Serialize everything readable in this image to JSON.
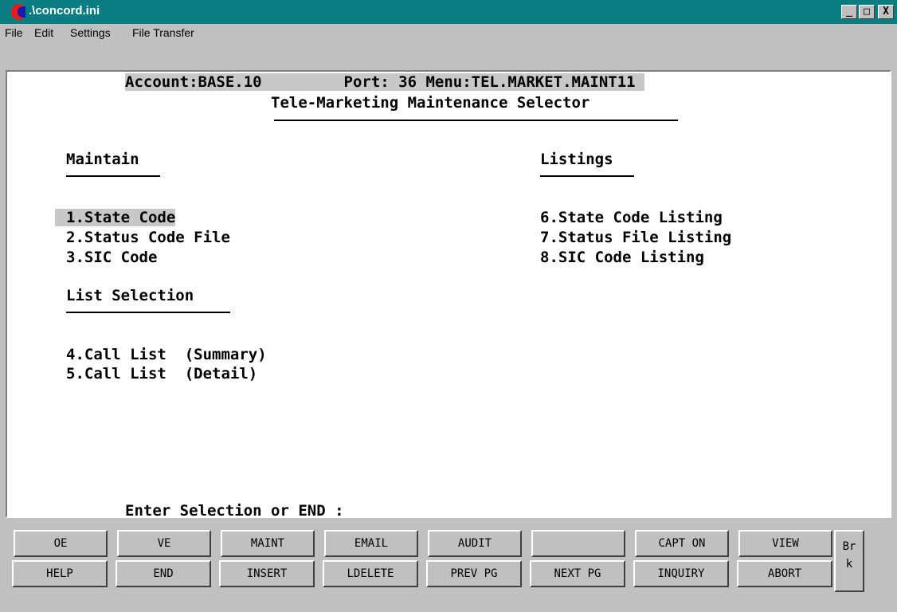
{
  "window": {
    "title": ".\\concord.ini",
    "minimize": "_",
    "maximize": "□",
    "close": "X"
  },
  "menu": [
    "File",
    "Edit",
    "Settings",
    "File Transfer"
  ],
  "screen": {
    "header": "Account:BASE.10         Port: 36 Menu:TEL.MARKET.MAINT11 ",
    "title": "Tele-Marketing Maintenance Selector",
    "maintain_heading": "Maintain",
    "listings_heading": "Listings",
    "list_selection_heading": "List Selection",
    "maintain_items": [
      "1.State Code",
      "2.Status Code File",
      "3.SIC Code"
    ],
    "listing_items": [
      "6.State Code Listing",
      "7.Status File Listing",
      "8.SIC Code Listing"
    ],
    "list_selection_items": [
      "4.Call List  (Summary)",
      "5.Call List  (Detail)"
    ],
    "prompt": "Enter Selection or END :"
  },
  "function_keys": {
    "row1": [
      "OE",
      "VE",
      "MAINT",
      "EMAIL",
      "AUDIT",
      "",
      "CAPT ON",
      "VIEW"
    ],
    "row2": [
      "HELP",
      "END",
      "INSERT",
      "LDELETE",
      "PREV PG",
      "NEXT PG",
      "INQUIRY",
      "ABORT"
    ],
    "break_line1": "Br",
    "break_line2": "k"
  }
}
